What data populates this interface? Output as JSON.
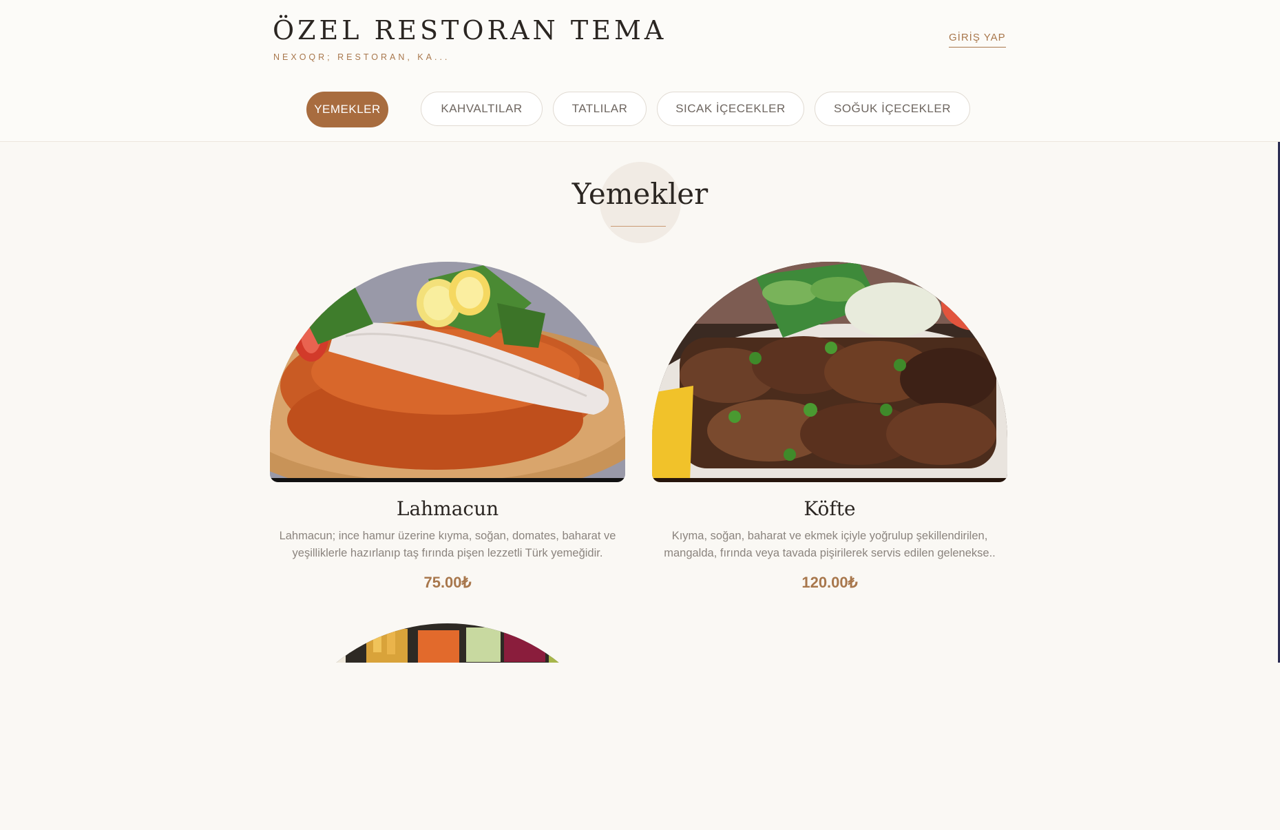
{
  "brand": {
    "title": "ÖZEL RESTORAN TEMA",
    "subtitle": "NEXOQR; RESTORAN, KA..."
  },
  "header": {
    "login_label": "GİRİŞ YAP"
  },
  "colors": {
    "accent": "#a86c3f",
    "gold": "#a8774c",
    "background": "#faf8f4"
  },
  "tabs": [
    {
      "label": "YEMEKLER",
      "active": true
    },
    {
      "label": "KAHVALTILAR",
      "active": false
    },
    {
      "label": "TATLILAR",
      "active": false
    },
    {
      "label": "SICAK İÇECEKLER",
      "active": false
    },
    {
      "label": "SOĞUK İÇECEKLER",
      "active": false
    }
  ],
  "section": {
    "title": "Yemekler"
  },
  "items": [
    {
      "name": "Lahmacun",
      "description": "Lahmacun; ince hamur üzerine kıyma, soğan, domates, baharat ve yeşilliklerle hazırlanıp taş fırında pişen lezzetli Türk yemeğidir.",
      "price": "75.00₺"
    },
    {
      "name": "Köfte",
      "description": "Kıyma, soğan, baharat ve ekmek içiyle yoğrulup şekillendirilen, mangalda, fırında veya tavada pişirilerek servis edilen gelenekse..",
      "price": "120.00₺"
    }
  ]
}
